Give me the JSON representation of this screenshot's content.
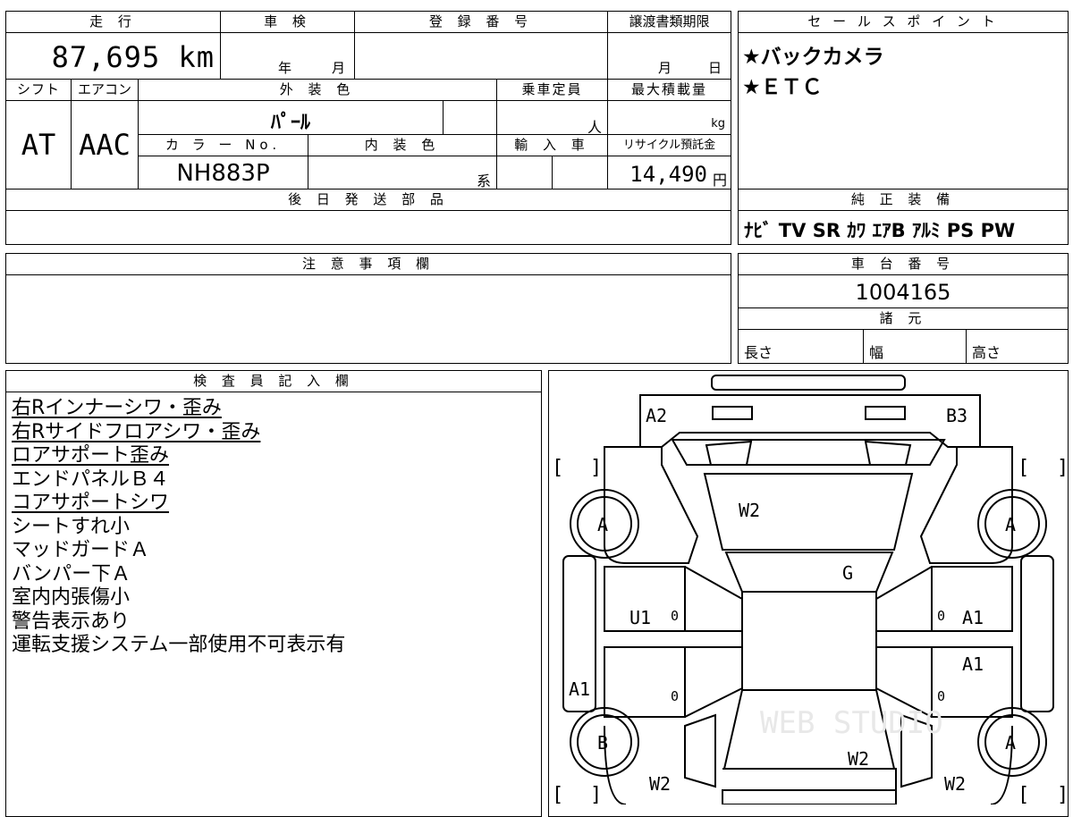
{
  "header": {
    "mileage_label": "走 行",
    "mileage_value": "87,695 km",
    "inspection_label": "車 検",
    "inspection_year": "年",
    "inspection_month": "月",
    "registration_label": "登 録 番 号",
    "transfer_label": "譲渡書類期限",
    "transfer_month": "月",
    "transfer_day": "日",
    "shift_label": "シフト",
    "shift_value": "AT",
    "ac_label": "エアコン",
    "ac_value": "AAC",
    "exterior_label": "外 装 色",
    "exterior_value": "ﾊﾟｰﾙ",
    "capacity_label": "乗車定員",
    "capacity_unit": "人",
    "maxload_label": "最大積載量",
    "maxload_unit": "kg",
    "color_no_label": "カ ラ ー No.",
    "color_no_value": "NH883P",
    "interior_label": "内 装 色",
    "interior_unit": "系",
    "import_label": "輸 入 車",
    "recycle_label": "リサイクル預託金",
    "recycle_value": "14,490",
    "recycle_unit": "円",
    "later_parts_label": "後 日 発 送 部 品"
  },
  "sales": {
    "label": "セ ー ル ス ポ イ ン ト",
    "points": [
      "★バックカメラ",
      "★ＥＴＣ"
    ]
  },
  "equipment": {
    "label": "純 正 装 備",
    "value": "ﾅﾋﾞ TV SR ｶﾜ ｴｱB ｱﾙﾐ PS PW"
  },
  "caution": {
    "label": "注 意 事 項 欄"
  },
  "chassis": {
    "label": "車 台 番 号",
    "value": "1004165"
  },
  "specs": {
    "label": "諸 元",
    "length": "長さ",
    "width": "幅",
    "height": "高さ"
  },
  "inspector": {
    "label": "検 査 員 記 入 欄",
    "notes": [
      {
        "text": "右Rインナーシワ・歪み",
        "underline": true
      },
      {
        "text": "右Rサイドフロアシワ・歪み",
        "underline": true
      },
      {
        "text": "ロアサポート歪み",
        "underline": true
      },
      {
        "text": "エンドパネルＢ４",
        "underline": false
      },
      {
        "text": "コアサポートシワ",
        "underline": true
      },
      {
        "text": "シートすれ小",
        "underline": false
      },
      {
        "text": "マッドガードＡ",
        "underline": false
      },
      {
        "text": "バンパー下Ａ",
        "underline": false
      },
      {
        "text": "室内内張傷小",
        "underline": false
      },
      {
        "text": "警告表示あり",
        "underline": false
      },
      {
        "text": "運転支援システム一部使用不可表示有",
        "underline": false
      }
    ]
  },
  "diagram": {
    "marks": {
      "rear_left": "A2",
      "rear_right": "B3",
      "rear_glass": "W2",
      "roof": "G",
      "left_rear_door": "U1",
      "right_rear_door": "A1",
      "right_front_door": "A1",
      "left_sill": "A1",
      "wheel_rl": "A",
      "wheel_rr": "A",
      "wheel_fl": "B",
      "wheel_fr": "A",
      "windshield": "W2",
      "front_left_glass": "W2",
      "front_right_glass": "W2",
      "zero": "0",
      "bracket_open": "[",
      "bracket_close": "]",
      "watermark": "WEB STUDIO"
    }
  }
}
